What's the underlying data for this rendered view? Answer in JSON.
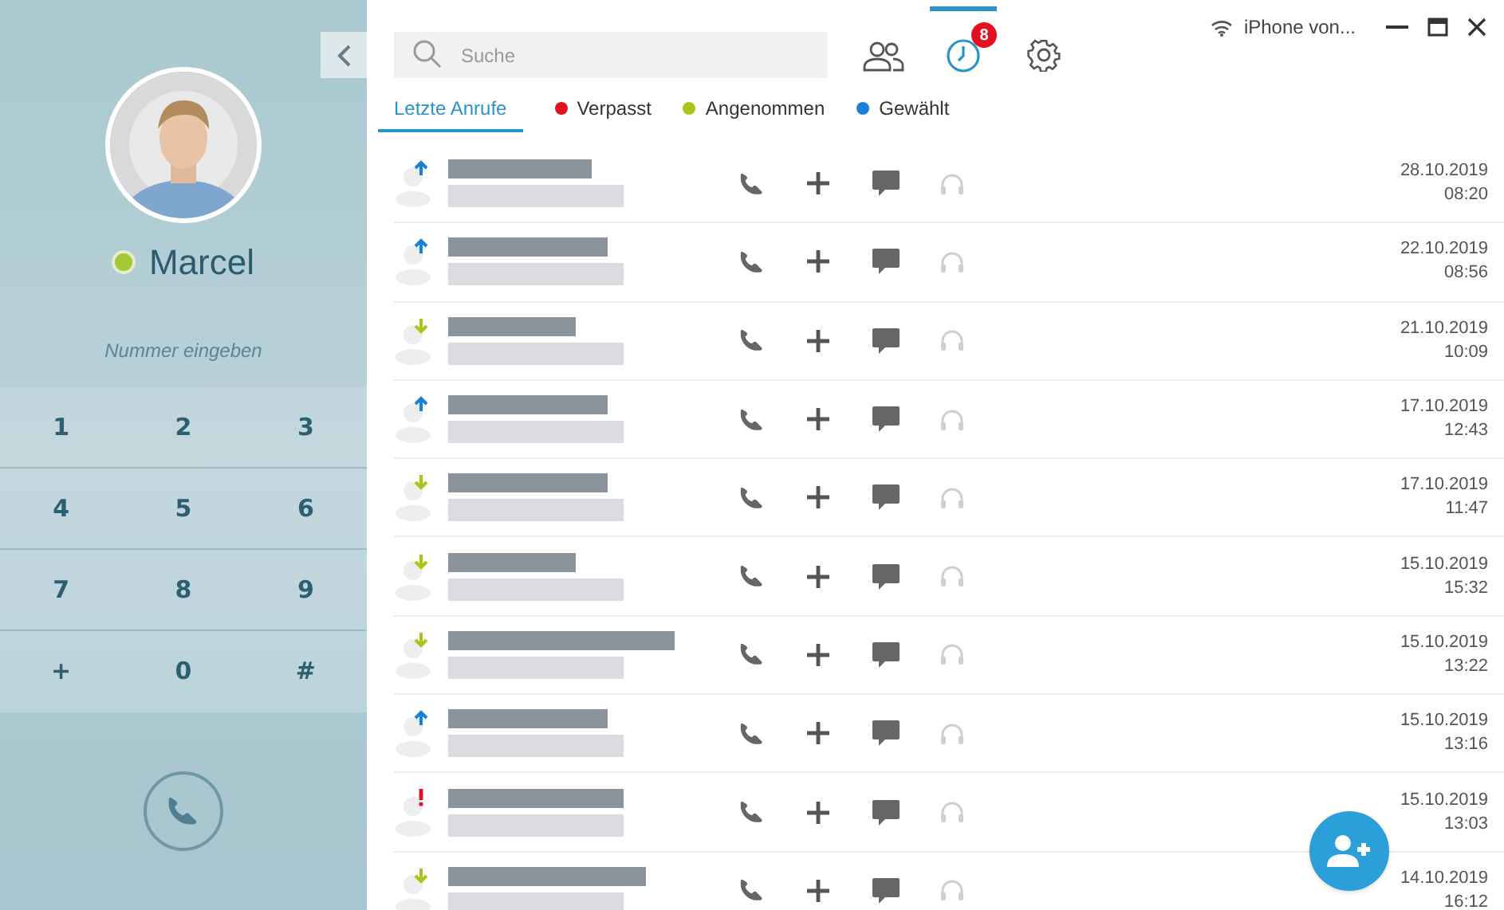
{
  "profile": {
    "name": "Marcel",
    "online": true,
    "number_placeholder": "Nummer eingeben"
  },
  "keypad": [
    "1",
    "2",
    "3",
    "4",
    "5",
    "6",
    "7",
    "8",
    "9",
    "+",
    "0",
    "#"
  ],
  "search": {
    "placeholder": "Suche"
  },
  "toolbar": {
    "history_badge": "8",
    "device": "iPhone von..."
  },
  "filters": [
    {
      "label": "Letzte Anrufe",
      "selected": true
    },
    {
      "label": "Verpasst",
      "selected": false,
      "color": "#e3101f"
    },
    {
      "label": "Angenommen",
      "selected": false,
      "color": "#a8c61a"
    },
    {
      "label": "Gewählt",
      "selected": false,
      "color": "#1a7fd6"
    }
  ],
  "calls": [
    {
      "kind": "outgoing",
      "date": "28.10.2019",
      "time": "08:20"
    },
    {
      "kind": "outgoing",
      "date": "22.10.2019",
      "time": "08:56"
    },
    {
      "kind": "incoming",
      "date": "21.10.2019",
      "time": "10:09"
    },
    {
      "kind": "outgoing",
      "date": "17.10.2019",
      "time": "12:43"
    },
    {
      "kind": "incoming",
      "date": "17.10.2019",
      "time": "11:47"
    },
    {
      "kind": "incoming",
      "date": "15.10.2019",
      "time": "15:32"
    },
    {
      "kind": "incoming",
      "date": "15.10.2019",
      "time": "13:22"
    },
    {
      "kind": "outgoing",
      "date": "15.10.2019",
      "time": "13:16"
    },
    {
      "kind": "missed",
      "date": "15.10.2019",
      "time": "13:03"
    },
    {
      "kind": "incoming",
      "date": "14.10.2019",
      "time": "16:12"
    }
  ]
}
